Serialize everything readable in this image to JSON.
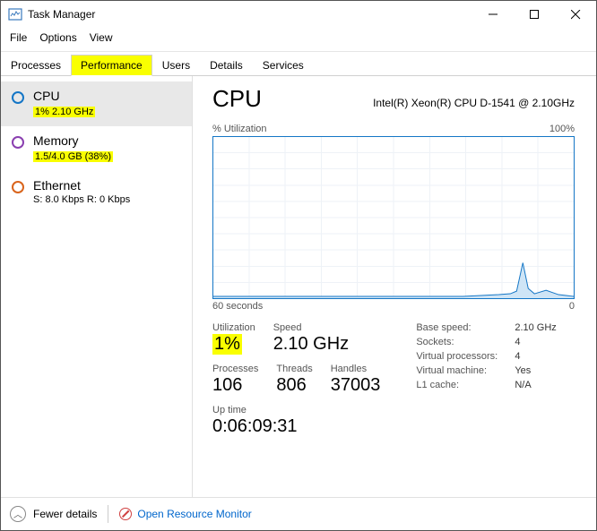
{
  "window": {
    "title": "Task Manager"
  },
  "menu": {
    "file": "File",
    "options": "Options",
    "view": "View"
  },
  "tabs": {
    "processes": "Processes",
    "performance": "Performance",
    "users": "Users",
    "details": "Details",
    "services": "Services"
  },
  "sidebar": {
    "cpu": {
      "label": "CPU",
      "sub": "1%  2.10 GHz"
    },
    "memory": {
      "label": "Memory",
      "sub": "1.5/4.0 GB (38%)"
    },
    "ethernet": {
      "label": "Ethernet",
      "sub": "S: 8.0 Kbps  R: 0 Kbps"
    }
  },
  "main": {
    "title": "CPU",
    "model": "Intel(R) Xeon(R) CPU D-1541 @ 2.10GHz",
    "chart_top_left": "% Utilization",
    "chart_top_right": "100%",
    "chart_bottom_left": "60 seconds",
    "chart_bottom_right": "0",
    "stats": {
      "utilization_label": "Utilization",
      "utilization": "1%",
      "speed_label": "Speed",
      "speed": "2.10 GHz",
      "processes_label": "Processes",
      "processes": "106",
      "threads_label": "Threads",
      "threads": "806",
      "handles_label": "Handles",
      "handles": "37003",
      "uptime_label": "Up time",
      "uptime": "0:06:09:31"
    },
    "info": {
      "base_speed_k": "Base speed:",
      "base_speed": "2.10 GHz",
      "sockets_k": "Sockets:",
      "sockets": "4",
      "vprocs_k": "Virtual processors:",
      "vprocs": "4",
      "vm_k": "Virtual machine:",
      "vm": "Yes",
      "l1_k": "L1 cache:",
      "l1": "N/A"
    }
  },
  "footer": {
    "fewer": "Fewer details",
    "monitor": "Open Resource Monitor"
  },
  "chart_data": {
    "type": "line",
    "title": "CPU % Utilization",
    "xlabel": "seconds ago",
    "ylabel": "% Utilization",
    "xlim": [
      60,
      0
    ],
    "ylim": [
      0,
      100
    ],
    "x": [
      60,
      55,
      50,
      45,
      40,
      35,
      30,
      25,
      20,
      15,
      12,
      10,
      9,
      8,
      6,
      4,
      2,
      0
    ],
    "values": [
      1,
      1,
      1,
      1,
      1,
      1,
      1,
      1,
      1,
      1,
      3,
      5,
      22,
      6,
      3,
      5,
      2,
      1
    ]
  }
}
